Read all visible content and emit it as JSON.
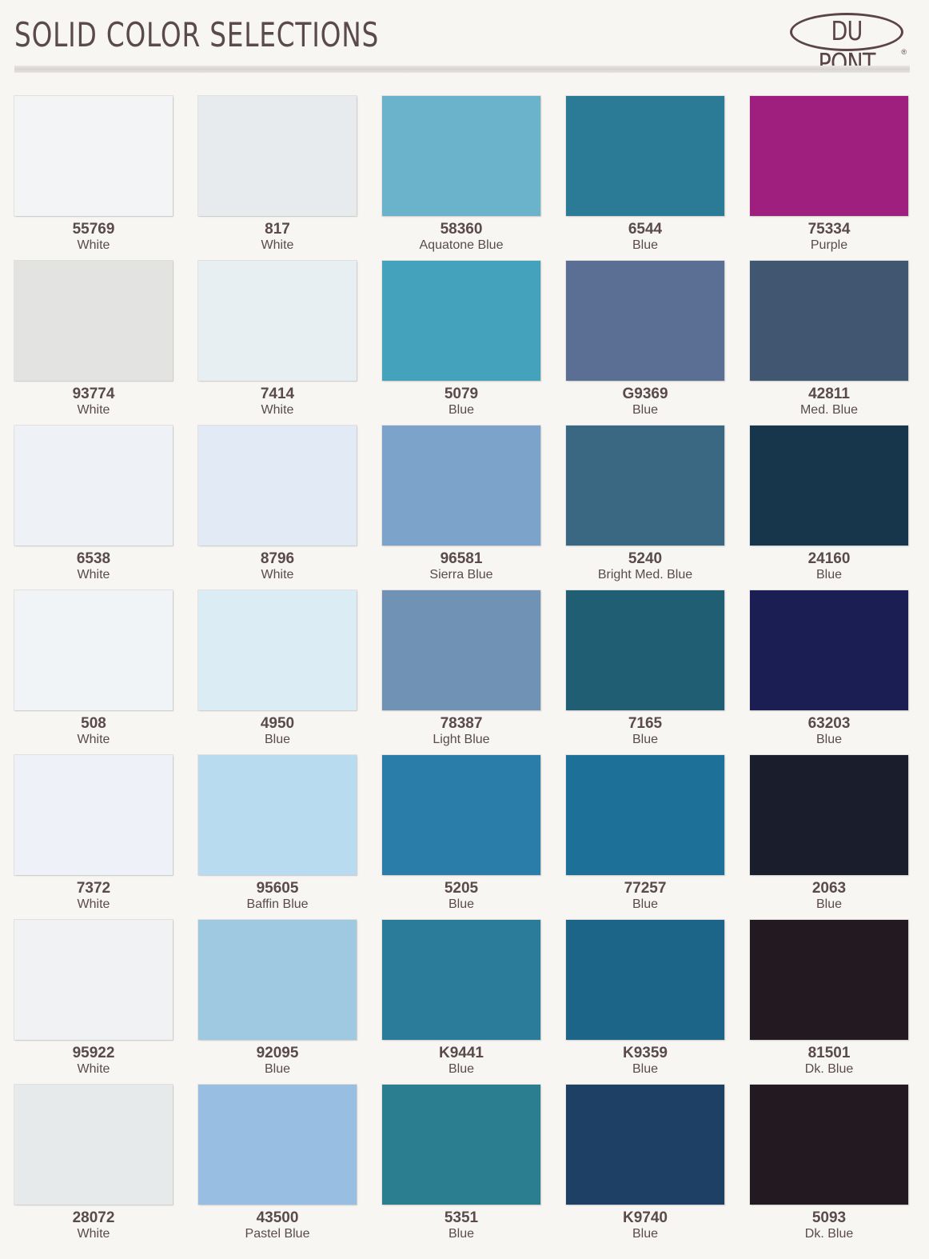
{
  "header": {
    "title": "SOLID COLOR SELECTIONS",
    "logo_text": "DU PONT",
    "logo_mark": "®"
  },
  "chips": [
    [
      {
        "code": "55769",
        "name": "White",
        "color": "#f3f4f6"
      },
      {
        "code": "817",
        "name": "White",
        "color": "#e7ebee"
      },
      {
        "code": "58360",
        "name": "Aquatone Blue",
        "color": "#6ab3ca"
      },
      {
        "code": "6544",
        "name": "Blue",
        "color": "#2b7b96"
      },
      {
        "code": "75334",
        "name": "Purple",
        "color": "#9e1f7e"
      }
    ],
    [
      {
        "code": "93774",
        "name": "White",
        "color": "#e3e3e2"
      },
      {
        "code": "7414",
        "name": "White",
        "color": "#e8eff3"
      },
      {
        "code": "5079",
        "name": "Blue",
        "color": "#44a2bd"
      },
      {
        "code": "G9369",
        "name": "Blue",
        "color": "#5b6f95"
      },
      {
        "code": "42811",
        "name": "Med. Blue",
        "color": "#405671"
      }
    ],
    [
      {
        "code": "6538",
        "name": "White",
        "color": "#eef1f6"
      },
      {
        "code": "8796",
        "name": "White",
        "color": "#e1eaf5"
      },
      {
        "code": "96581",
        "name": "Sierra Blue",
        "color": "#7ca4ca"
      },
      {
        "code": "5240",
        "name": "Bright Med. Blue",
        "color": "#3a6883"
      },
      {
        "code": "24160",
        "name": "Blue",
        "color": "#17364c"
      }
    ],
    [
      {
        "code": "508",
        "name": "White",
        "color": "#f1f4f6"
      },
      {
        "code": "4950",
        "name": "Blue",
        "color": "#dbecf5"
      },
      {
        "code": "78387",
        "name": "Light Blue",
        "color": "#7093b5"
      },
      {
        "code": "7165",
        "name": "Blue",
        "color": "#1f5e73"
      },
      {
        "code": "63203",
        "name": "Blue",
        "color": "#1b1e52"
      }
    ],
    [
      {
        "code": "7372",
        "name": "White",
        "color": "#eef2f8"
      },
      {
        "code": "95605",
        "name": "Baffin Blue",
        "color": "#b8dbef"
      },
      {
        "code": "5205",
        "name": "Blue",
        "color": "#297da8"
      },
      {
        "code": "77257",
        "name": "Blue",
        "color": "#1d7199"
      },
      {
        "code": "2063",
        "name": "Blue",
        "color": "#1a1d2c"
      }
    ],
    [
      {
        "code": "95922",
        "name": "White",
        "color": "#f1f2f4"
      },
      {
        "code": "92095",
        "name": "Blue",
        "color": "#9fc9e1"
      },
      {
        "code": "K9441",
        "name": "Blue",
        "color": "#2b7c9b"
      },
      {
        "code": "K9359",
        "name": "Blue",
        "color": "#1c6589"
      },
      {
        "code": "81501",
        "name": "Dk. Blue",
        "color": "#221a20"
      }
    ],
    [
      {
        "code": "28072",
        "name": "White",
        "color": "#e7eaeb"
      },
      {
        "code": "43500",
        "name": "Pastel Blue",
        "color": "#98bfe1"
      },
      {
        "code": "5351",
        "name": "Blue",
        "color": "#2a7e8f"
      },
      {
        "code": "K9740",
        "name": "Blue",
        "color": "#1d4064"
      },
      {
        "code": "5093",
        "name": "Dk. Blue",
        "color": "#231a21"
      }
    ]
  ]
}
